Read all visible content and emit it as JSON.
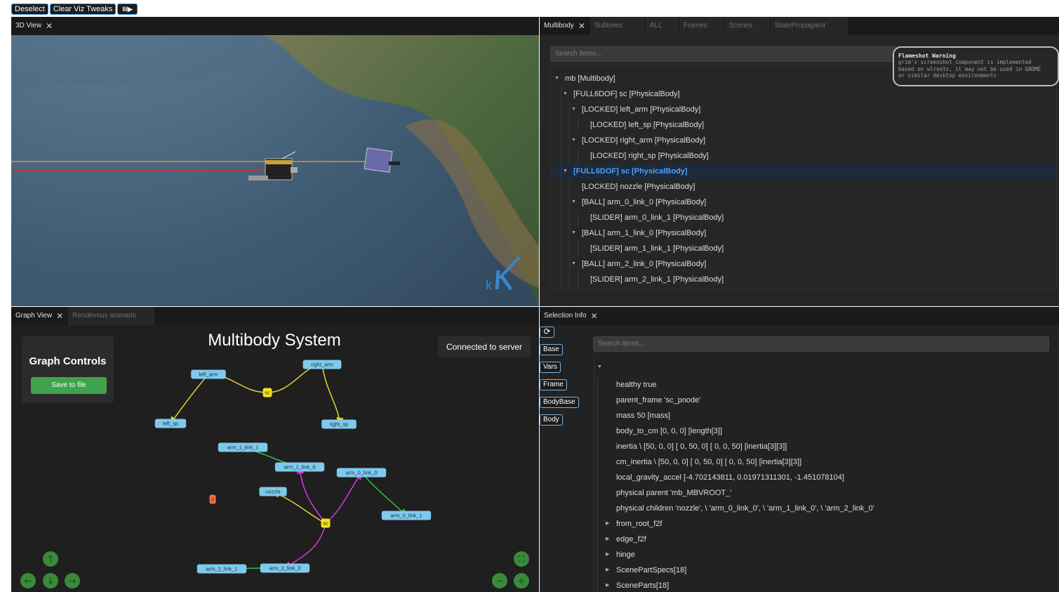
{
  "toolbar": {
    "deselect": "Deselect",
    "clear_viz": "Clear Viz Tweaks",
    "playpause": "II/▶"
  },
  "view3d": {
    "tab": "3D View",
    "logo_letter": "k"
  },
  "multibody": {
    "tabs": [
      "Multibody",
      "Subtrees",
      "ALL",
      "Frames",
      "Scenes",
      "StatePropagator"
    ],
    "search_placeholder": "Search items...",
    "tree": [
      {
        "label": "mb [Multibody]",
        "depth": 0,
        "caret": true,
        "selected": false
      },
      {
        "label": "[FULL6DOF] sc [PhysicalBody]",
        "depth": 1,
        "caret": true,
        "selected": false
      },
      {
        "label": "[LOCKED] left_arm [PhysicalBody]",
        "depth": 2,
        "caret": true,
        "selected": false
      },
      {
        "label": "[LOCKED] left_sp [PhysicalBody]",
        "depth": 3,
        "caret": false,
        "selected": false
      },
      {
        "label": "[LOCKED] right_arm [PhysicalBody]",
        "depth": 2,
        "caret": true,
        "selected": false
      },
      {
        "label": "[LOCKED] right_sp [PhysicalBody]",
        "depth": 3,
        "caret": false,
        "selected": false
      },
      {
        "label": "[FULL6DOF] sc [PhysicalBody]",
        "depth": 1,
        "caret": true,
        "selected": true
      },
      {
        "label": "[LOCKED] nozzle [PhysicalBody]",
        "depth": 2,
        "caret": false,
        "selected": false
      },
      {
        "label": "[BALL] arm_0_link_0 [PhysicalBody]",
        "depth": 2,
        "caret": true,
        "selected": false
      },
      {
        "label": "[SLIDER] arm_0_link_1 [PhysicalBody]",
        "depth": 3,
        "caret": false,
        "selected": false
      },
      {
        "label": "[BALL] arm_1_link_0 [PhysicalBody]",
        "depth": 2,
        "caret": true,
        "selected": false
      },
      {
        "label": "[SLIDER] arm_1_link_1 [PhysicalBody]",
        "depth": 3,
        "caret": false,
        "selected": false
      },
      {
        "label": "[BALL] arm_2_link_0 [PhysicalBody]",
        "depth": 2,
        "caret": true,
        "selected": false
      },
      {
        "label": "[SLIDER] arm_2_link_1 [PhysicalBody]",
        "depth": 3,
        "caret": false,
        "selected": false
      }
    ]
  },
  "flameshot": {
    "title": "Flameshot Warning",
    "lines": [
      "grim's screenshot component is implemented",
      "based on wlroots, it may not be used in GNOME",
      "or similar desktop environments"
    ]
  },
  "graph": {
    "tabs": [
      "Graph View",
      "Rendevous scenario"
    ],
    "controls_title": "Graph Controls",
    "save_label": "Save to file",
    "title": "Multibody System",
    "status": "Connected to server",
    "nodes": [
      {
        "id": "left_arm",
        "label": "left_arm",
        "kind": "body"
      },
      {
        "id": "right_arm",
        "label": "right_arm",
        "kind": "body"
      },
      {
        "id": "sc1",
        "label": "sc",
        "kind": "root"
      },
      {
        "id": "left_sp",
        "label": "left_sp",
        "kind": "body"
      },
      {
        "id": "right_sp",
        "label": "right_sp",
        "kind": "body"
      },
      {
        "id": "arm_1_link_1",
        "label": "arm_1_link_1",
        "kind": "body"
      },
      {
        "id": "arm_1_link_0",
        "label": "arm_1_link_0",
        "kind": "body"
      },
      {
        "id": "arm_0_link_0",
        "label": "arm_0_link_0",
        "kind": "body"
      },
      {
        "id": "nozzle",
        "label": "nozzle",
        "kind": "body"
      },
      {
        "id": "zero",
        "label": "0",
        "kind": "orphan"
      },
      {
        "id": "sc2",
        "label": "sc",
        "kind": "root"
      },
      {
        "id": "arm_0_link_1",
        "label": "arm_0_link_1",
        "kind": "body"
      },
      {
        "id": "arm_2_link_1",
        "label": "arm_2_link_1",
        "kind": "body"
      },
      {
        "id": "arm_2_link_0",
        "label": "arm_2_link_0",
        "kind": "body"
      }
    ],
    "edges": [
      {
        "from": "sc1",
        "to": "left_arm",
        "type": "LOCKED"
      },
      {
        "from": "sc1",
        "to": "right_arm",
        "type": "LOCKED"
      },
      {
        "from": "left_arm",
        "to": "left_sp",
        "type": "LOCKED"
      },
      {
        "from": "right_arm",
        "to": "right_sp",
        "type": "LOCKED"
      },
      {
        "from": "sc2",
        "to": "nozzle",
        "type": "LOCKED"
      },
      {
        "from": "sc2",
        "to": "arm_1_link_0",
        "type": "BALL"
      },
      {
        "from": "sc2",
        "to": "arm_0_link_0",
        "type": "BALL"
      },
      {
        "from": "sc2",
        "to": "arm_2_link_0",
        "type": "BALL"
      },
      {
        "from": "arm_1_link_0",
        "to": "arm_1_link_1",
        "type": "SLIDER"
      },
      {
        "from": "arm_0_link_0",
        "to": "arm_0_link_1",
        "type": "SLIDER"
      },
      {
        "from": "arm_2_link_0",
        "to": "arm_2_link_1",
        "type": "SLIDER"
      }
    ],
    "colors": {
      "LOCKED": "#e6d22e",
      "BALL": "#d63ad6",
      "SLIDER": "#2fbf37",
      "node": "#7fc9ec",
      "root": "#f2e21c",
      "orphan": "#f07045",
      "nav": "#3a8a3a"
    }
  },
  "selection": {
    "tab": "Selection Info",
    "search_placeholder": "Search items...",
    "buttons": [
      "Base",
      "Vars",
      "Frame",
      "BodyBase",
      "Body"
    ],
    "rows": [
      {
        "label": "healthy true",
        "caret": false
      },
      {
        "label": "parent_frame 'sc_pnode'",
        "caret": false
      },
      {
        "label": "mass 50 [mass]",
        "caret": false
      },
      {
        "label": "body_to_cm [0, 0, 0] [length[3]]",
        "caret": false
      },
      {
        "label": "inertia \\ [50, 0, 0] [ 0, 50, 0] [ 0, 0, 50] [inertia[3][3]]",
        "caret": false
      },
      {
        "label": "cm_inertia \\ [50, 0, 0] [ 0, 50, 0] [ 0, 0, 50] [inertia[3][3]]",
        "caret": false
      },
      {
        "label": "local_gravity_accel [-4.702143811, 0.01971311301, -1.451078104]",
        "caret": false
      },
      {
        "label": "physical parent 'mb_MBVROOT_'",
        "caret": false
      },
      {
        "label": "physical children 'nozzle', \\ 'arm_0_link_0', \\ 'arm_1_link_0', \\ 'arm_2_link_0'",
        "caret": false
      },
      {
        "label": "from_root_f2f",
        "caret": true
      },
      {
        "label": "edge_f2f",
        "caret": true
      },
      {
        "label": "hinge",
        "caret": true
      },
      {
        "label": "ScenePartSpecs[18]",
        "caret": true
      },
      {
        "label": "SceneParts[18]",
        "caret": true
      }
    ]
  }
}
